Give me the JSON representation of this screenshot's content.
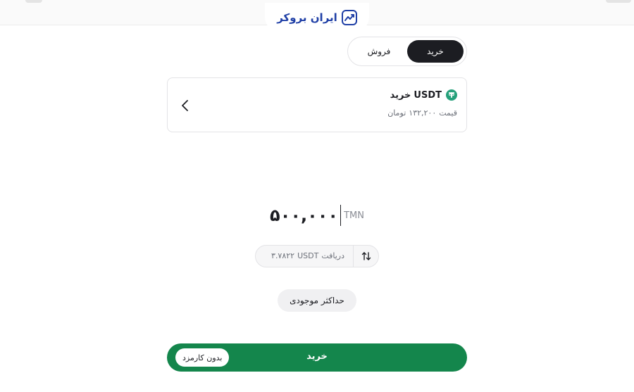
{
  "brand": {
    "name": "ایران بروکر",
    "color": "#1f3fa6"
  },
  "trade_toggle": {
    "buy_label": "خرید",
    "sell_label": "فروش",
    "selected": "buy"
  },
  "asset": {
    "title": "خرید",
    "symbol": "USDT",
    "icon": "tether-icon",
    "icon_color": "#26a17b",
    "price_label": "قیمت",
    "price_value": "۱۳۲,۲۰۰",
    "price_unit": "تومان"
  },
  "amount": {
    "value": "۵۰۰,۰۰۰",
    "unit": "TMN"
  },
  "receive": {
    "label": "دریافت",
    "symbol": "USDT",
    "value": "۳.۷۸۲۲"
  },
  "max_balance_label": "حداکثر موجودی",
  "submit": {
    "label": "خرید",
    "fee_badge": "بدون کارمزد",
    "color": "#14864c"
  }
}
